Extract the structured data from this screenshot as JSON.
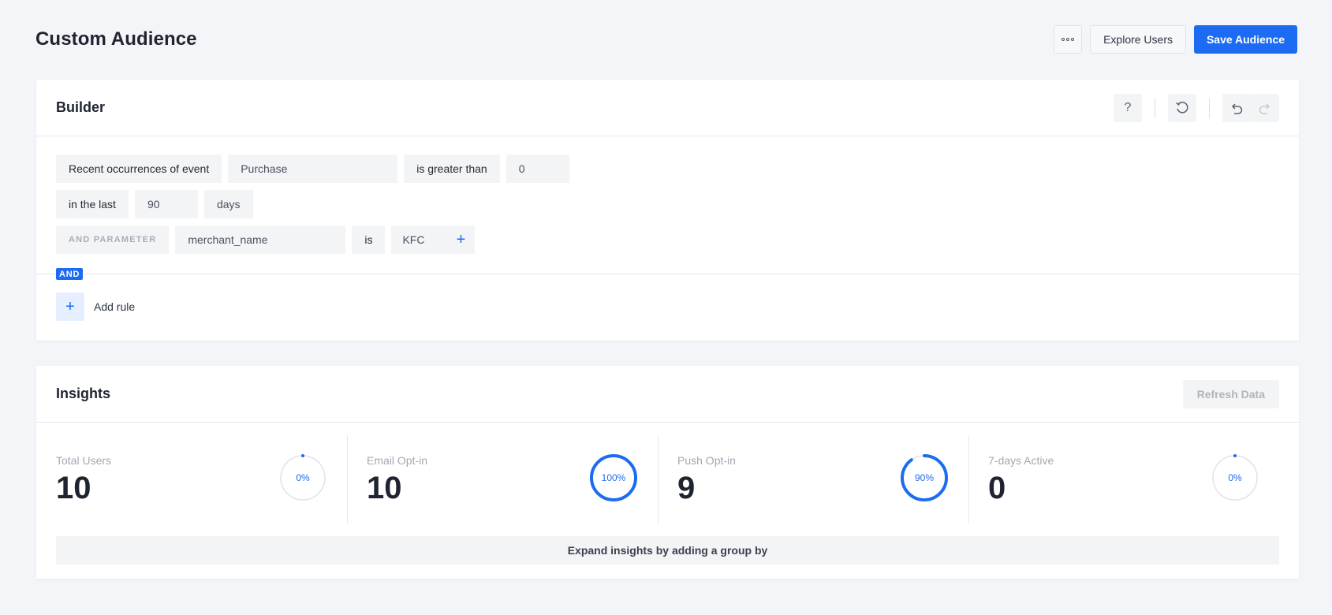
{
  "header": {
    "title": "Custom Audience",
    "more_icon": "more-horizontal-icon",
    "explore_label": "Explore Users",
    "save_label": "Save Audience"
  },
  "builder": {
    "title": "Builder",
    "tools": [
      "help-icon",
      "reset-icon",
      "undo-icon",
      "redo-icon"
    ],
    "help_glyph": "?",
    "rule": {
      "row1": {
        "label": "Recent occurrences of event",
        "event": "Purchase",
        "operator": "is greater than",
        "value": "0"
      },
      "row2": {
        "prefix": "in the last",
        "amount": "90",
        "unit": "days"
      },
      "row3": {
        "param_label": "AND PARAMETER",
        "param_name": "merchant_name",
        "operator": "is",
        "value": "KFC",
        "plus": "+"
      }
    },
    "and_badge": "AND",
    "add_rule": {
      "plus": "+",
      "label": "Add rule"
    }
  },
  "insights": {
    "title": "Insights",
    "refresh_label": "Refresh Data",
    "metrics": [
      {
        "label": "Total Users",
        "value": "10",
        "percent": 0,
        "percent_label": "0%"
      },
      {
        "label": "Email Opt-in",
        "value": "10",
        "percent": 100,
        "percent_label": "100%"
      },
      {
        "label": "Push Opt-in",
        "value": "9",
        "percent": 90,
        "percent_label": "90%"
      },
      {
        "label": "7-days Active",
        "value": "0",
        "percent": 0,
        "percent_label": "0%"
      }
    ],
    "expand_label": "Expand insights by adding a group by"
  },
  "colors": {
    "accent": "#1b6cf2",
    "ring_track": "#e1e3e7"
  }
}
